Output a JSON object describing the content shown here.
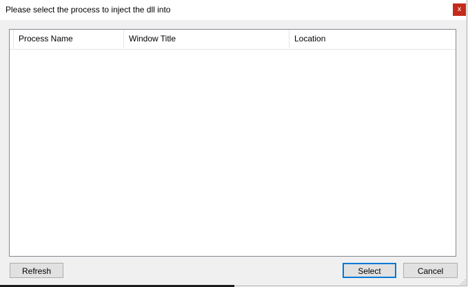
{
  "dialog": {
    "title": "Please select the process to inject the dll into",
    "close_label": "x",
    "close_color": "#c42b1c"
  },
  "list": {
    "columns": [
      "Process Name",
      "Window Title",
      "Location"
    ],
    "rows": []
  },
  "buttons": {
    "refresh_label": "Refresh",
    "select_label": "Select",
    "cancel_label": "Cancel",
    "default_accent": "#0078d7"
  }
}
